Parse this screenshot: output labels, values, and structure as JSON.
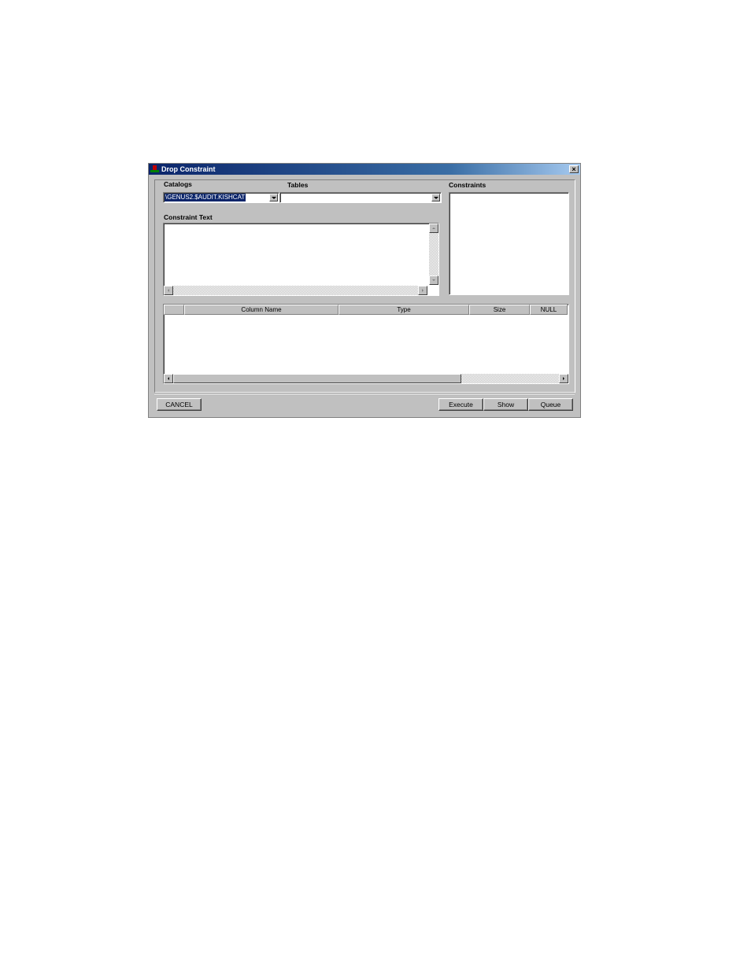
{
  "window": {
    "title": "Drop Constraint",
    "close_label": "×",
    "icon": "app-icon"
  },
  "catalogs": {
    "label": "Catalogs",
    "selected_value": "\\GENUS2.$AUDIT.KISHCAT"
  },
  "tables": {
    "label": "Tables",
    "selected_value": ""
  },
  "constraints": {
    "label": "Constraints",
    "items": []
  },
  "constraint_text": {
    "label": "Constraint Text",
    "value": ""
  },
  "columns_grid": {
    "headers": [
      "",
      "Column Name",
      "Type",
      "Size",
      "NULL"
    ],
    "rows": []
  },
  "buttons": {
    "cancel": "CANCEL",
    "execute": "Execute",
    "show": "Show",
    "queue": "Queue"
  }
}
